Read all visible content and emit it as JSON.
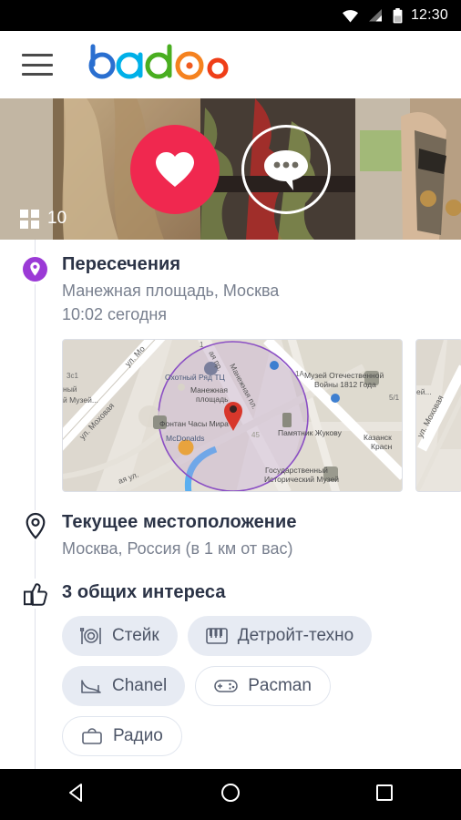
{
  "statusbar": {
    "time": "12:30",
    "icons": [
      "wifi-icon",
      "signal-icon",
      "battery-icon"
    ]
  },
  "appbar": {
    "menu_icon": "hamburger-menu-icon",
    "logo_text": "badoo",
    "logo_colors": {
      "b": "#2a6fd0",
      "a": "#00b0e8",
      "d": "#49ae20",
      "o_big": "#f5821f",
      "o_big_dot": "#f05a20",
      "o_small": "#ef3e18"
    }
  },
  "hero": {
    "like_button_label": "heart-icon",
    "like_button_color": "#f0284f",
    "chat_button_label": "chat-bubble-icon",
    "photo_count": "10",
    "photo_count_icon": "grid-icon"
  },
  "sections": {
    "crossings": {
      "icon": "location-pin-filled-icon",
      "icon_color": "#9b3ad6",
      "title": "Пересечения",
      "place": "Манежная площадь, Москва",
      "time": "10:02 сегодня"
    },
    "current_location": {
      "icon": "location-pin-outline-icon",
      "title": "Текущее местоположение",
      "value": "Москва, Россия (в 1 км от вас)"
    },
    "interests": {
      "icon": "thumbs-up-icon",
      "title": "3 общих интереса",
      "chips": [
        {
          "label": "Стейк",
          "icon": "plate-cutlery-icon",
          "style": "filled"
        },
        {
          "label": "Детройт-техно",
          "icon": "piano-keys-icon",
          "style": "filled"
        },
        {
          "label": "Chanel",
          "icon": "high-heel-icon",
          "style": "filled"
        },
        {
          "label": "Pacman",
          "icon": "gamepad-icon",
          "style": "outline"
        },
        {
          "label": "Радио",
          "icon": "bag-icon",
          "style": "outline"
        }
      ]
    }
  },
  "map": {
    "marker_color": "#d8372b",
    "highlight_circle_color": "#8b4fc4",
    "labels": {
      "l1": "3с1",
      "l2": "ный",
      "l3": "й Музей...",
      "l4": "ул. Моховая",
      "l5": "ул. Мо",
      "l6": "Охотный Ряд ТЦ",
      "l7": "Манежная площадь",
      "l8": "ая пр.",
      "l9": "Манежная пл.",
      "l10": "1",
      "l11": "1А",
      "l12": "Музей Отечественной",
      "l13": "Войны 1812 Года",
      "l14": "Фонтан Часы Мира",
      "l15": "McDonalds",
      "l16": "45",
      "l17": "Памятник Жукову",
      "l18": "Государственный",
      "l19": "Исторический Музей",
      "l20": "Казанск",
      "l21": "Красн",
      "l22": "5/1",
      "l23": "ая ул.",
      "next_card_label1": "ей...",
      "next_card_label2": "ул. Моховая"
    }
  },
  "navbar": {
    "back": "back-triangle-icon",
    "home": "home-circle-icon",
    "recents": "recents-square-icon"
  }
}
